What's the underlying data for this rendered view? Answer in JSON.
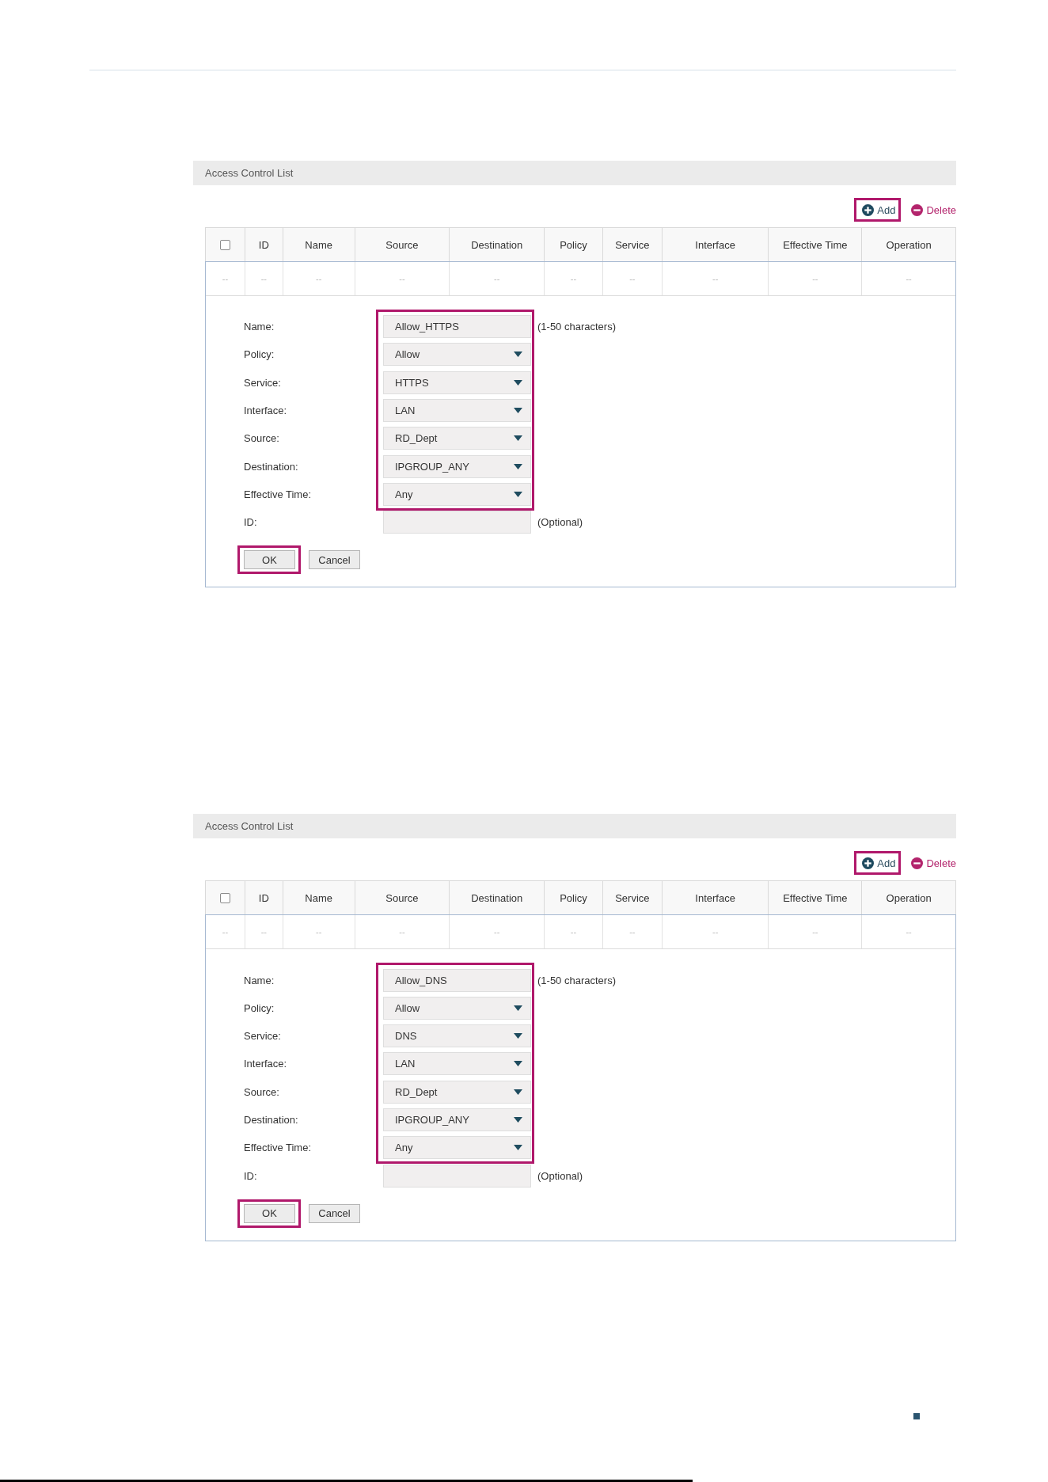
{
  "panels": [
    {
      "title": "Access Control List",
      "toolbar": [
        {
          "kind": "add",
          "label": "Add",
          "highlighted": true
        },
        {
          "kind": "delete",
          "label": "Delete",
          "highlighted": false
        }
      ],
      "table": {
        "select_all": {
          "checked": false
        },
        "columns": [
          "",
          "ID",
          "Name",
          "Source",
          "Destination",
          "Policy",
          "Service",
          "Interface",
          "Effective Time",
          "Operation"
        ],
        "rows": [
          [
            "--",
            "--",
            "--",
            "--",
            "--",
            "--",
            "--",
            "--",
            "--",
            "--"
          ]
        ]
      },
      "form": {
        "groups": [
          {
            "highlighted": true,
            "fields": [
              {
                "label": "Name:",
                "kind": "text",
                "value": "Allow_HTTPS",
                "note": "(1-50 characters)"
              },
              {
                "label": "Policy:",
                "kind": "select",
                "value": "Allow"
              },
              {
                "label": "Service:",
                "kind": "select",
                "value": "HTTPS"
              },
              {
                "label": "Interface:",
                "kind": "select",
                "value": "LAN"
              },
              {
                "label": "Source:",
                "kind": "select",
                "value": "RD_Dept"
              },
              {
                "label": "Destination:",
                "kind": "select",
                "value": "IPGROUP_ANY"
              },
              {
                "label": "Effective Time:",
                "kind": "select",
                "value": "Any"
              }
            ]
          },
          {
            "highlighted": false,
            "fields": [
              {
                "label": "ID:",
                "kind": "text",
                "note": "(Optional)"
              }
            ]
          }
        ],
        "buttons": [
          {
            "label": "OK",
            "highlighted": true
          },
          {
            "label": "Cancel",
            "highlighted": false
          }
        ]
      }
    },
    {
      "title": "Access Control List",
      "toolbar": [
        {
          "kind": "add",
          "label": "Add",
          "highlighted": true
        },
        {
          "kind": "delete",
          "label": "Delete",
          "highlighted": false
        }
      ],
      "table": {
        "select_all": {
          "checked": false
        },
        "columns": [
          "",
          "ID",
          "Name",
          "Source",
          "Destination",
          "Policy",
          "Service",
          "Interface",
          "Effective Time",
          "Operation"
        ],
        "rows": [
          [
            "--",
            "--",
            "--",
            "--",
            "--",
            "--",
            "--",
            "--",
            "--",
            "--"
          ]
        ]
      },
      "form": {
        "groups": [
          {
            "highlighted": true,
            "fields": [
              {
                "label": "Name:",
                "kind": "text",
                "value": "Allow_DNS",
                "note": "(1-50 characters)"
              },
              {
                "label": "Policy:",
                "kind": "select",
                "value": "Allow"
              },
              {
                "label": "Service:",
                "kind": "select",
                "value": "DNS"
              },
              {
                "label": "Interface:",
                "kind": "select",
                "value": "LAN"
              },
              {
                "label": "Source:",
                "kind": "select",
                "value": "RD_Dept"
              },
              {
                "label": "Destination:",
                "kind": "select",
                "value": "IPGROUP_ANY"
              },
              {
                "label": "Effective Time:",
                "kind": "select",
                "value": "Any"
              }
            ]
          },
          {
            "highlighted": false,
            "fields": [
              {
                "label": "ID:",
                "kind": "text",
                "note": "(Optional)"
              }
            ]
          }
        ],
        "buttons": [
          {
            "label": "OK",
            "highlighted": true
          },
          {
            "label": "Cancel",
            "highlighted": false
          }
        ]
      }
    }
  ]
}
